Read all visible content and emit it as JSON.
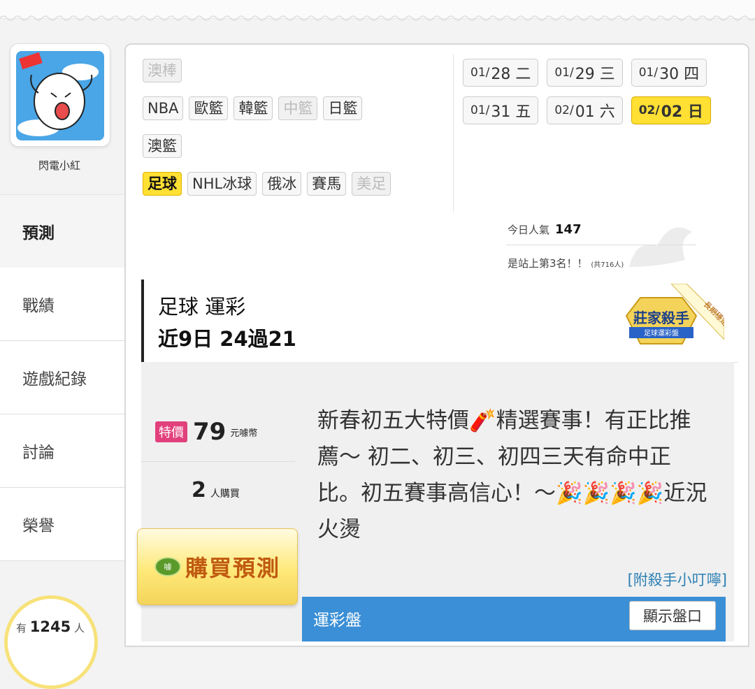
{
  "user": {
    "name": "閃電小紅"
  },
  "nav": {
    "items": [
      {
        "label": "預測"
      },
      {
        "label": "戰績"
      },
      {
        "label": "遊戲紀錄"
      },
      {
        "label": "討論"
      },
      {
        "label": "榮譽"
      }
    ]
  },
  "counter": {
    "prefix": "有",
    "value": "1245",
    "suffix": "人"
  },
  "sports": {
    "rows": [
      [
        "澳棒"
      ],
      [
        "NBA",
        "歐籃",
        "韓籃",
        "中籃",
        "日籃"
      ],
      [
        "澳籃"
      ],
      [
        "足球",
        "NHL冰球",
        "俄冰",
        "賽馬",
        "美足"
      ]
    ]
  },
  "dates": [
    {
      "md": "01/",
      "day": "28 二"
    },
    {
      "md": "01/",
      "day": "29 三"
    },
    {
      "md": "01/",
      "day": "30 四"
    },
    {
      "md": "01/",
      "day": "31 五"
    },
    {
      "md": "02/",
      "day": "01 六"
    },
    {
      "md": "02/",
      "day": "02 日"
    }
  ],
  "popularity": {
    "label": "今日人氣",
    "value": "147",
    "rank_text": "是站上第3名！！",
    "total": "(共716人)"
  },
  "header": {
    "title": "足球 運彩",
    "record": "近9日 24過21",
    "badge_title": "莊家殺手",
    "badge_sub": "足球運彩盤",
    "ribbon": "長期穩定"
  },
  "offer": {
    "tag": "特價",
    "price": "79",
    "unit": "元噱幣",
    "buyers": "2",
    "buyers_unit": "人購買",
    "buy_label": "購買預測",
    "coin": "噱"
  },
  "description": "新春初五大特價🧨精選賽事！有正比推薦～ 初二、初三、初四三天有命中正比。初五賽事高信心！～🎉🎉🎉🎉近況火燙",
  "note": "[附殺手小叮嚀]",
  "bar": {
    "title": "運彩盤",
    "button": "顯示盤口"
  },
  "colors": {
    "accent_yellow": "#ffe033",
    "special_pink": "#e2407c",
    "bar_blue": "#3a8fd6",
    "link_blue": "#2b7fb4"
  }
}
